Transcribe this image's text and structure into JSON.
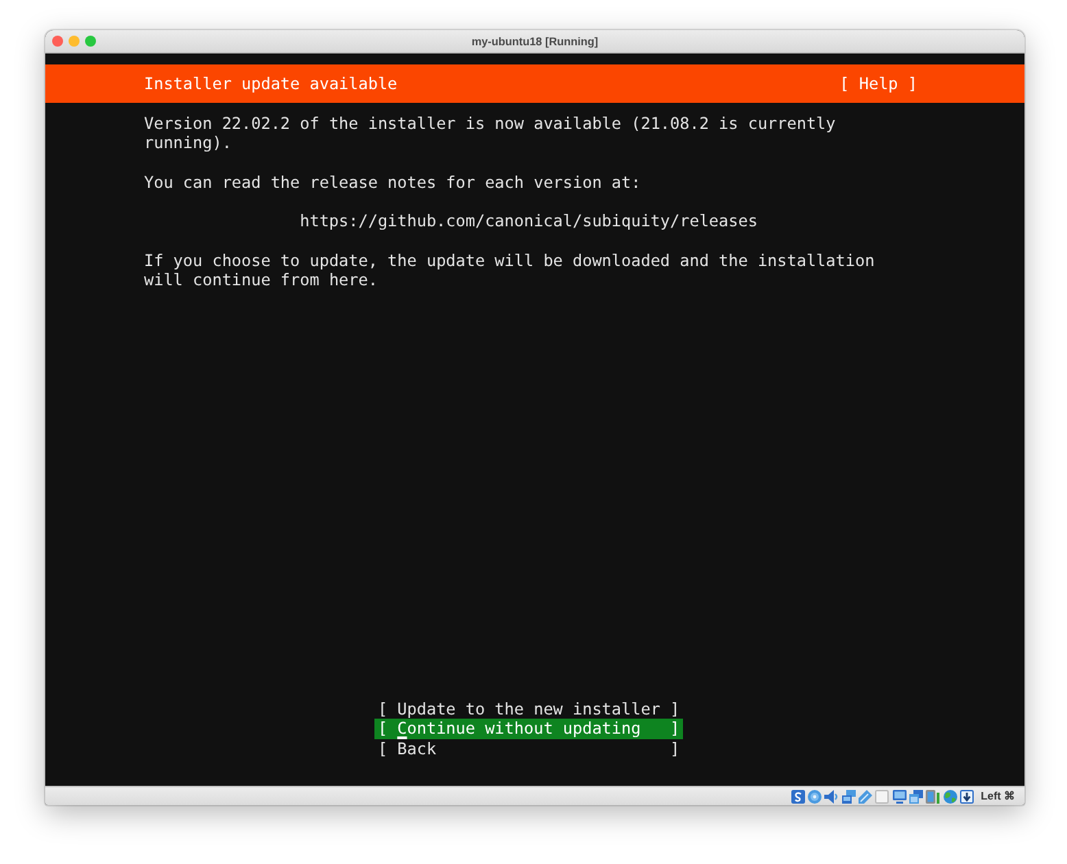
{
  "window": {
    "title": "my-ubuntu18 [Running]"
  },
  "header": {
    "title": "Installer update available",
    "help": "[ Help ]"
  },
  "body": {
    "paragraphs": [
      {
        "kind": "text",
        "text": "Version 22.02.2 of the installer is now available (21.08.2 is currently running)."
      },
      {
        "kind": "text",
        "text": "You can read the release notes for each version at:"
      },
      {
        "kind": "url",
        "text": "https://github.com/canonical/subiquity/releases"
      },
      {
        "kind": "text",
        "text": "If you choose to update, the update will be downloaded and the installation will continue from here."
      }
    ]
  },
  "menu": {
    "open": "[",
    "close": "]",
    "items": [
      {
        "label": "Update to the new installer",
        "selected": false
      },
      {
        "label": "Continue without updating",
        "selected": true
      },
      {
        "label": "Back",
        "selected": false
      }
    ]
  },
  "status_bar": {
    "host_key": "Left ⌘"
  }
}
